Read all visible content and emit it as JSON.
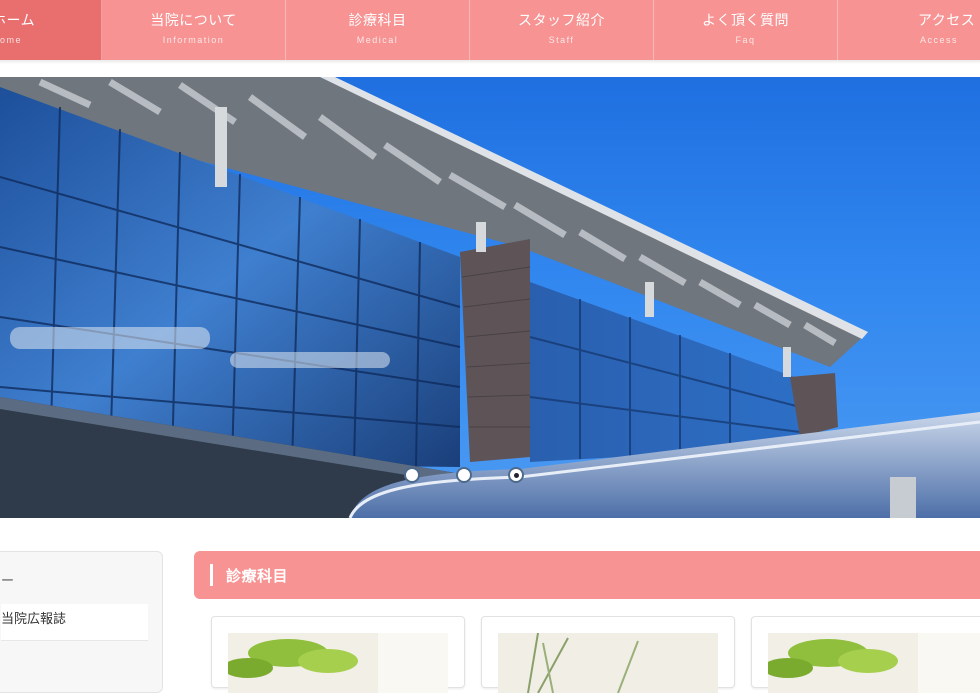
{
  "nav": {
    "items": [
      {
        "label_jp": "ホーム",
        "label_en": "Home"
      },
      {
        "label_jp": "当院について",
        "label_en": "Information"
      },
      {
        "label_jp": "診療科目",
        "label_en": "Medical"
      },
      {
        "label_jp": "スタッフ紹介",
        "label_en": "Staff"
      },
      {
        "label_jp": "よく頂く質問",
        "label_en": "Faq"
      },
      {
        "label_jp": "アクセス",
        "label_en": "Access"
      }
    ]
  },
  "slider": {
    "total_slides": 3,
    "active_slide": 3
  },
  "sidebar": {
    "title": "ー",
    "link": "当院広報誌"
  },
  "main": {
    "section_title": "診療科目"
  },
  "colors": {
    "nav_bg": "#f79393",
    "nav_active": "#e96e6e",
    "sky": "#2f86ee"
  }
}
